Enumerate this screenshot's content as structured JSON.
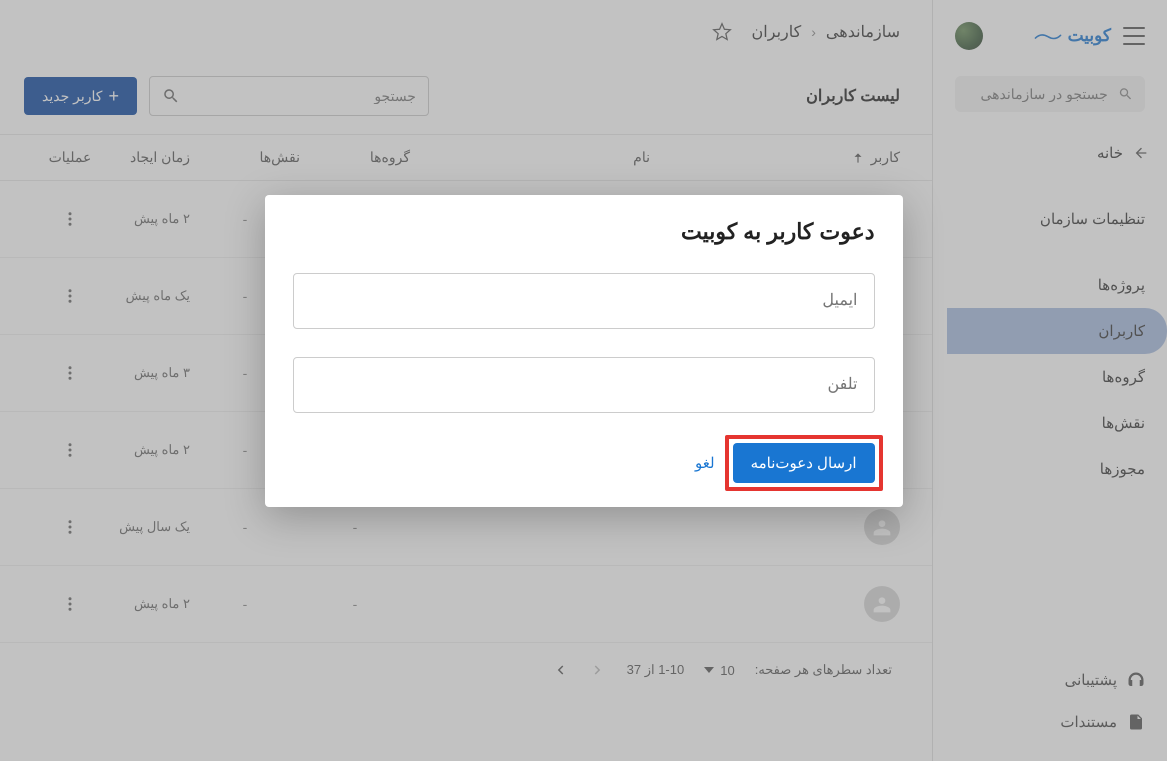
{
  "brand": {
    "name": "کوبیت"
  },
  "sidebar": {
    "search_placeholder": "جستجو در سازماندهی",
    "items": [
      {
        "label": "خانه",
        "icon": "arrow-left"
      },
      {
        "label": "تنظیمات سازمان"
      },
      {
        "label": "پروژه‌ها"
      },
      {
        "label": "کاربران",
        "active": true
      },
      {
        "label": "گروه‌ها"
      },
      {
        "label": "نقش‌ها"
      },
      {
        "label": "مجوزها"
      }
    ],
    "bottom": [
      {
        "label": "پشتیبانی",
        "icon": "support"
      },
      {
        "label": "مستندات",
        "icon": "doc"
      }
    ]
  },
  "breadcrumb": {
    "root": "سازماندهی",
    "current": "کاربران"
  },
  "list": {
    "title": "لیست کاربران",
    "search_placeholder": "جستجو",
    "new_button": "کاربر جدید",
    "columns": {
      "user": "کاربر",
      "name": "نام",
      "groups": "گروه‌ها",
      "roles": "نقش‌ها",
      "time": "زمان ایجاد",
      "actions": "عملیات"
    },
    "rows": [
      {
        "time": "۲ ماه پیش",
        "groups": "-",
        "roles": "-"
      },
      {
        "time": "یک ماه پیش",
        "groups": "-",
        "roles": "-"
      },
      {
        "time": "۳ ماه پیش",
        "groups": "-",
        "roles": "-"
      },
      {
        "time": "۲ ماه پیش",
        "groups": "-",
        "roles": "-"
      },
      {
        "time": "یک سال پیش",
        "groups": "-",
        "roles": "-"
      },
      {
        "time": "۲ ماه پیش",
        "groups": "-",
        "roles": "-"
      }
    ],
    "pagination": {
      "rows_label": "تعداد سطرهای هر صفحه:",
      "rows_value": "10",
      "range": "1-10 از 37"
    }
  },
  "modal": {
    "title": "دعوت کاربر به کوبیت",
    "email_placeholder": "ایمیل",
    "phone_placeholder": "تلفن",
    "send": "ارسال دعوت‌نامه",
    "cancel": "لغو"
  }
}
